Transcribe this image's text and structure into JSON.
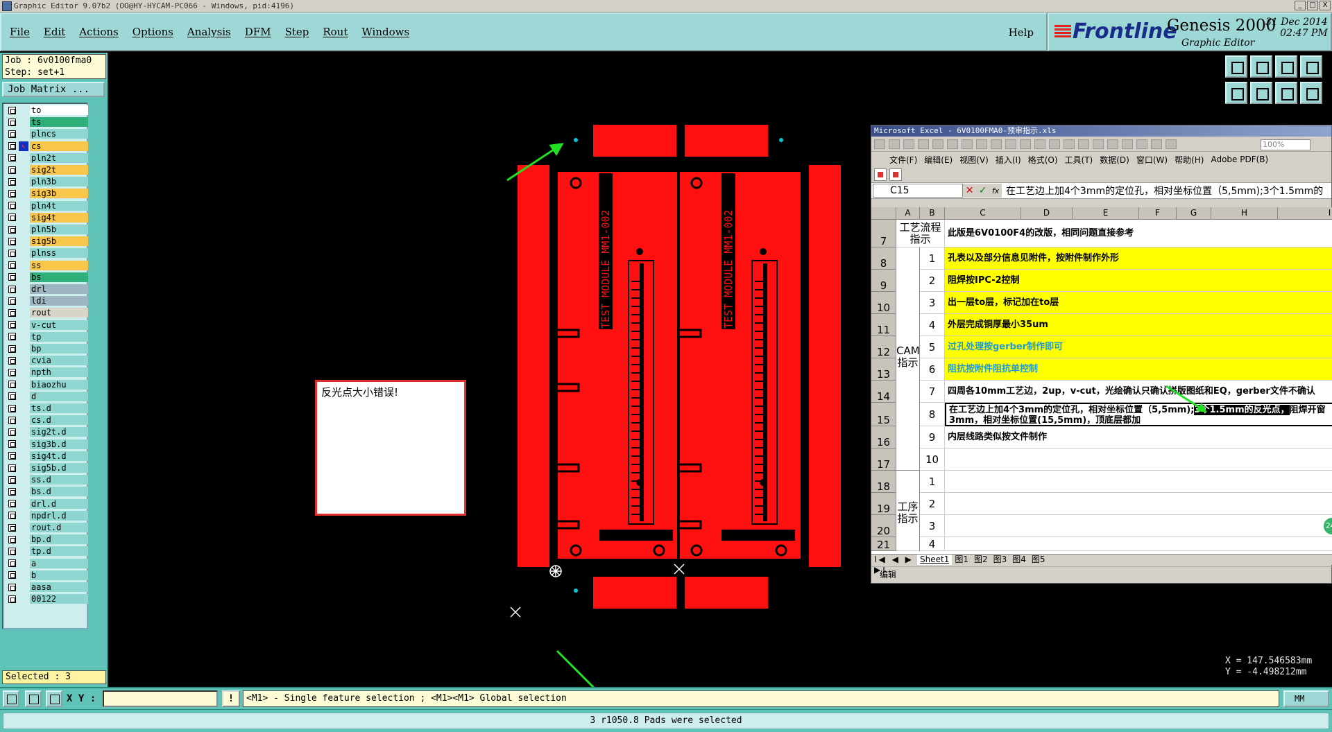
{
  "window": {
    "title": "Graphic Editor 9.07b2 (OO@HY-HYCAM-PC066 - Windows, pid:4196)",
    "controls": [
      "_",
      "□",
      "X"
    ]
  },
  "menu": {
    "items": [
      "File",
      "Edit",
      "Actions",
      "Options",
      "Analysis",
      "DFM",
      "Step",
      "Rout",
      "Windows"
    ],
    "help": "Help"
  },
  "logo": {
    "brand": "Frontline",
    "product": "Genesis 2000",
    "subtitle": "Graphic Editor",
    "date": "31 Dec 2014",
    "time": "02:47 PM"
  },
  "job": {
    "job_line": "Job : 6v0100fma0",
    "step_line": "Step: set+1",
    "matrix_button": "Job Matrix ..."
  },
  "layers": [
    {
      "name": "to",
      "type": "board"
    },
    {
      "name": "ts",
      "type": "mask"
    },
    {
      "name": "plncs",
      "type": "plain"
    },
    {
      "name": "cs",
      "type": "sel",
      "work": true
    },
    {
      "name": "pln2t",
      "type": "plain"
    },
    {
      "name": "sig2t",
      "type": "sig"
    },
    {
      "name": "pln3b",
      "type": "plain"
    },
    {
      "name": "sig3b",
      "type": "sig"
    },
    {
      "name": "pln4t",
      "type": "plain"
    },
    {
      "name": "sig4t",
      "type": "sig"
    },
    {
      "name": "pln5b",
      "type": "plain"
    },
    {
      "name": "sig5b",
      "type": "sig"
    },
    {
      "name": "plnss",
      "type": "plain"
    },
    {
      "name": "ss",
      "type": "sig"
    },
    {
      "name": "bs",
      "type": "mask"
    },
    {
      "name": "drl",
      "type": "drill"
    },
    {
      "name": "ldi",
      "type": "drill"
    },
    {
      "name": "rout",
      "type": "rout"
    },
    {
      "name": "v-cut",
      "type": "plain"
    },
    {
      "name": "tp",
      "type": "plain"
    },
    {
      "name": "bp",
      "type": "plain"
    },
    {
      "name": "cvia",
      "type": "plain"
    },
    {
      "name": "npth",
      "type": "plain"
    },
    {
      "name": "biaozhu",
      "type": "plain"
    },
    {
      "name": "d",
      "type": "plain"
    },
    {
      "name": "ts.d",
      "type": "plain"
    },
    {
      "name": "cs.d",
      "type": "plain"
    },
    {
      "name": "sig2t.d",
      "type": "plain"
    },
    {
      "name": "sig3b.d",
      "type": "plain"
    },
    {
      "name": "sig4t.d",
      "type": "plain"
    },
    {
      "name": "sig5b.d",
      "type": "plain"
    },
    {
      "name": "ss.d",
      "type": "plain"
    },
    {
      "name": "bs.d",
      "type": "plain"
    },
    {
      "name": "drl.d",
      "type": "plain"
    },
    {
      "name": "npdrl.d",
      "type": "plain"
    },
    {
      "name": "rout.d",
      "type": "plain"
    },
    {
      "name": "bp.d",
      "type": "plain"
    },
    {
      "name": "tp.d",
      "type": "plain"
    },
    {
      "name": "a",
      "type": "plain"
    },
    {
      "name": "b",
      "type": "plain"
    },
    {
      "name": "aasa",
      "type": "plain"
    },
    {
      "name": "00122",
      "type": "plain"
    }
  ],
  "selected_count": "Selected : 3",
  "canvas": {
    "pcb_label": "TEST MODULE MM1-002",
    "popup_text": "反光点大小错误!"
  },
  "coords": {
    "x": "X = 147.546583mm",
    "y": "Y = -4.498212mm"
  },
  "excel": {
    "title": "Microsoft Excel - 6V0100FMA0-预审指示.xls",
    "zoom": "100%",
    "menu": [
      "文件(F)",
      "编辑(E)",
      "视图(V)",
      "插入(I)",
      "格式(O)",
      "工具(T)",
      "数据(D)",
      "窗口(W)",
      "帮助(H)",
      "Adobe PDF(B)"
    ],
    "namebox": "C15",
    "formula": "在工艺边上加4个3mm的定位孔，相对坐标位置（5,5mm);3个1.5mm的",
    "columns": [
      "A",
      "B",
      "C",
      "D",
      "E",
      "F",
      "G",
      "H",
      "I"
    ],
    "row_numbers": [
      "7",
      "8",
      "9",
      "10",
      "11",
      "12",
      "13",
      "14",
      "15",
      "16",
      "17",
      "18",
      "19",
      "20",
      "21"
    ],
    "section_process": "工艺流程指示",
    "section_cam": "CAM指示",
    "section_work": "工序指示",
    "row7_text": "此版是6V0100F4的改版，相同问题直接参考",
    "items": [
      {
        "n": "1",
        "text": "孔表以及部分信息见附件，按附件制作外形",
        "bg": "#ffff00",
        "color": "#000000"
      },
      {
        "n": "2",
        "text": "阻焊按IPC-2控制",
        "bg": "#ffff00",
        "color": "#000000"
      },
      {
        "n": "3",
        "text": "出一层to层，标记加在to层",
        "bg": "#ffff00",
        "color": "#000000"
      },
      {
        "n": "4",
        "text": "外层完成铜厚最小35um",
        "bg": "#ffff00",
        "color": "#000000"
      },
      {
        "n": "5",
        "text": "过孔处理按gerber制作即可",
        "bg": "#ffff00",
        "color": "#1e9ad6"
      },
      {
        "n": "6",
        "text": "阻抗按附件阻抗单控制",
        "bg": "#ffff00",
        "color": "#1e9ad6"
      },
      {
        "n": "7",
        "text": "四周各10mm工艺边，2up，v-cut，光绘确认只确认拼版图纸和EQ，gerber文件不确认",
        "bg": "#ffffff",
        "color": "#000000"
      },
      {
        "n": "8",
        "text": "在工艺边上加4个3mm的定位孔，相对坐标位置（5,5mm);",
        "bg": "#ffffff",
        "color": "#000000"
      },
      {
        "n": "9",
        "text": "内层线路类似按文件制作",
        "bg": "#ffffff",
        "color": "#000000"
      },
      {
        "n": "10",
        "text": "",
        "bg": "#ffffff",
        "color": "#000000"
      }
    ],
    "item8_highlight": "3个1.5mm的反光点，",
    "item8_rest": "阻焊开窗",
    "item8_line2": "3mm，相对坐标位置(15,5mm)，顶底层都加",
    "work_items": [
      "1",
      "2",
      "3",
      "4"
    ],
    "sheet_nav": "I◀ ◀ ▶ ▶I",
    "sheets": [
      "Sheet1",
      "图1",
      "图2",
      "图3",
      "图4",
      "图5"
    ],
    "status": "编辑"
  },
  "bottom": {
    "xy_label": "X Y :",
    "xy_value": "",
    "hint_icon": "!",
    "hint": "<M1> - Single feature selection ; <M1><M1> Global selection",
    "units": "MM"
  },
  "status_message": "3 r1050.8 Pads were selected",
  "badge": "24"
}
